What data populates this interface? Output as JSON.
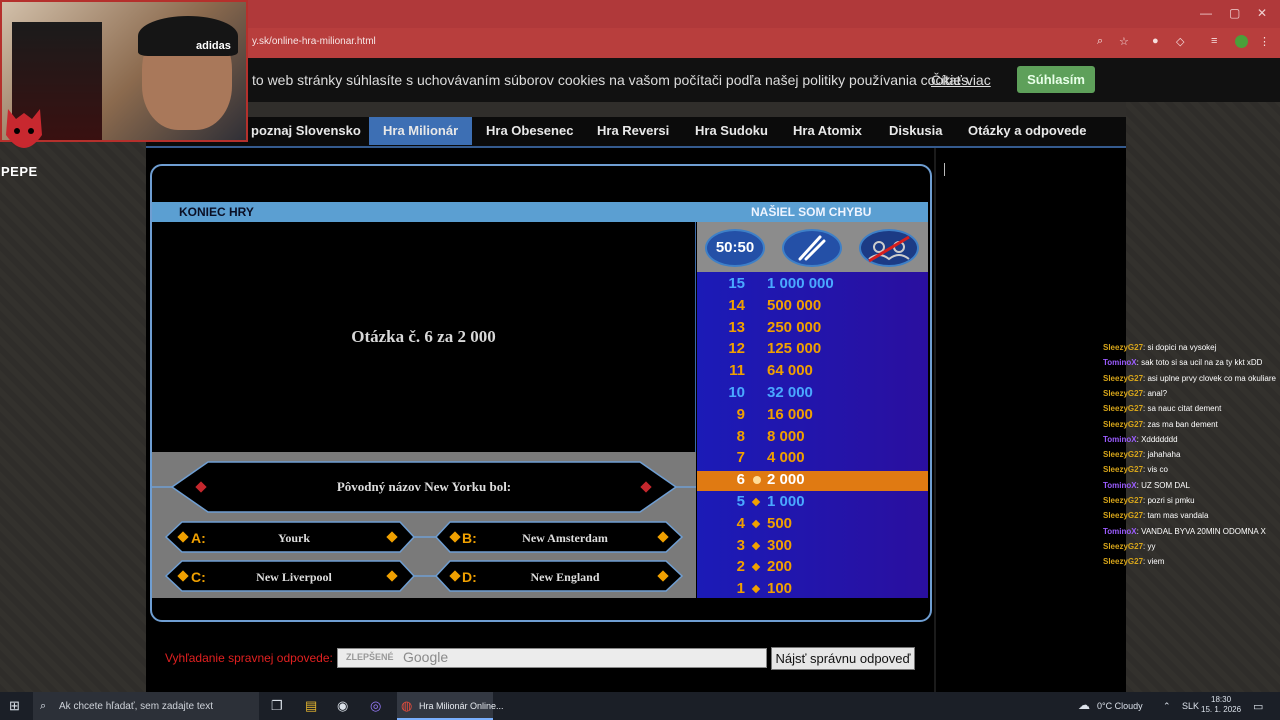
{
  "browser": {
    "url_fragment": "y.sk/online-hra-milionar.html",
    "controls": {
      "minimize": "—",
      "maximize": "▢",
      "close": "✕"
    }
  },
  "cookie": {
    "text": "to web stránky súhlasíte s uchovávaním súborov cookies na vašom počítači podľa našej politiky používania cookies.",
    "link": "Čítať viac",
    "button": "Súhlasím"
  },
  "nav": {
    "items": [
      {
        "label": "poznaj Slovensko"
      },
      {
        "label": "Hra Milionár",
        "active": true
      },
      {
        "label": "Hra Obesenec"
      },
      {
        "label": "Hra Reversi"
      },
      {
        "label": "Hra Sudoku"
      },
      {
        "label": "Hra Atomix"
      },
      {
        "label": "Diskusia"
      },
      {
        "label": "Otázky a odpovede"
      }
    ]
  },
  "game": {
    "end_game": "KONIEC HRY",
    "report_error": "NAŠIEL SOM CHYBU",
    "question_title": "Otázka č. 6 za 2 000",
    "question": "Pôvodný názov New Yorku bol:",
    "answers": [
      {
        "letter": "A:",
        "text": "Yourk"
      },
      {
        "letter": "B:",
        "text": "New Amsterdam"
      },
      {
        "letter": "C:",
        "text": "New Liverpool"
      },
      {
        "letter": "D:",
        "text": "New England"
      }
    ],
    "lifelines": {
      "fifty": "50:50",
      "phone": "phone-a-friend",
      "audience": "ask-the-audience (used)"
    },
    "ladder": [
      {
        "level": "15",
        "amount": "1 000 000",
        "milestone": true
      },
      {
        "level": "14",
        "amount": "500 000"
      },
      {
        "level": "13",
        "amount": "250 000"
      },
      {
        "level": "12",
        "amount": "125 000"
      },
      {
        "level": "11",
        "amount": "64 000"
      },
      {
        "level": "10",
        "amount": "32 000",
        "milestone": true
      },
      {
        "level": "9",
        "amount": "16 000"
      },
      {
        "level": "8",
        "amount": "8 000"
      },
      {
        "level": "7",
        "amount": "4 000"
      },
      {
        "level": "6",
        "amount": "2 000",
        "current": true
      },
      {
        "level": "5",
        "amount": "1 000",
        "milestone": true
      },
      {
        "level": "4",
        "amount": "500"
      },
      {
        "level": "3",
        "amount": "300"
      },
      {
        "level": "2",
        "amount": "200"
      },
      {
        "level": "1",
        "amount": "100"
      }
    ],
    "colors": {
      "frame": "#6f9ed2",
      "ladder": "#1b1bb7",
      "current": "#e07a12",
      "milestone_text": "#ffffff",
      "normal_text": "#f0a000"
    }
  },
  "search": {
    "label": "Vyhľadanie spravnej odpovede:",
    "brand": "ZLEPŠENÉ",
    "google": "Google",
    "button": "Nájsť správnu odpoveď"
  },
  "stream": {
    "cam_logo": "adidas",
    "channel": "PEPE",
    "chat": [
      {
        "user": "SleezyG27",
        "msg": ": si dopici na vysokej",
        "color": "#d7a51a"
      },
      {
        "user": "TominoX",
        "msg": ": sak toto si sa ucil na za ty kkt xDD",
        "color": "#9b5cff"
      },
      {
        "user": "SleezyG27",
        "msg": ": asi uplne prvy clovek co ma okuliare",
        "color": "#d7a51a"
      },
      {
        "user": "SleezyG27",
        "msg": ": anal?",
        "color": "#d7a51a"
      },
      {
        "user": "SleezyG27",
        "msg": ": sa nauc citat dement",
        "color": "#d7a51a"
      },
      {
        "user": "SleezyG27",
        "msg": ": zas ma ban dement",
        "color": "#d7a51a"
      },
      {
        "user": "TominoX",
        "msg": ": Xddddddd",
        "color": "#9b5cff"
      },
      {
        "user": "SleezyG27",
        "msg": ": jahahaha",
        "color": "#d7a51a"
      },
      {
        "user": "SleezyG27",
        "msg": ": vis co",
        "color": "#d7a51a"
      },
      {
        "user": "TominoX",
        "msg": ": UZ SOM DAL",
        "color": "#9b5cff"
      },
      {
        "user": "SleezyG27",
        "msg": ": pozri si pmku",
        "color": "#d7a51a"
      },
      {
        "user": "SleezyG27",
        "msg": ": tam mas vandala",
        "color": "#d7a51a"
      },
      {
        "user": "TominoX",
        "msg": ": VANDAL BYVA 20MIN ODOMNA X",
        "color": "#9b5cff"
      },
      {
        "user": "SleezyG27",
        "msg": ": yy",
        "color": "#d7a51a"
      },
      {
        "user": "SleezyG27",
        "msg": ": viem",
        "color": "#d7a51a"
      }
    ]
  },
  "taskbar": {
    "search_placeholder": "Ak chcete hľadať, sem zadajte text",
    "app": "Hra Milionár Online...",
    "weather": "0°C  Cloudy",
    "lang": "SLK",
    "time": "18:30",
    "date": "15. 1. 2026"
  }
}
